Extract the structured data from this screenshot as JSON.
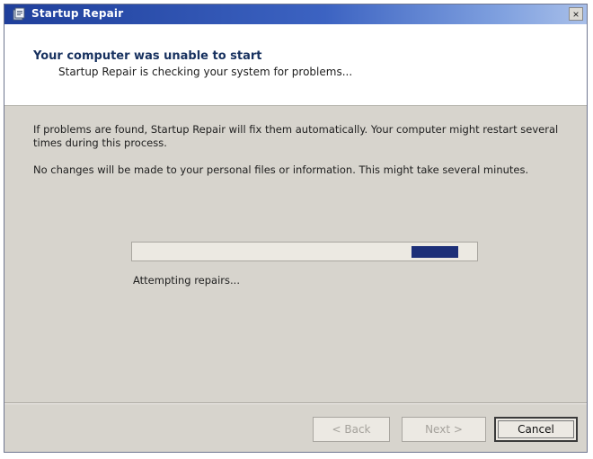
{
  "window": {
    "title": "Startup Repair",
    "close_glyph": "×",
    "icon": "app-icon"
  },
  "header": {
    "title": "Your computer was unable to start",
    "subtitle": "Startup Repair is checking your system for problems..."
  },
  "body": {
    "paragraph1": "If problems are found, Startup Repair will fix them automatically. Your computer might restart several times during this process.",
    "paragraph2": "No changes will be made to your personal files or information. This might take several minutes."
  },
  "progress": {
    "style": "marquee",
    "status": "Attempting repairs...",
    "color": "#1d2f78"
  },
  "buttons": {
    "back": "< Back",
    "next": "Next >",
    "cancel": "Cancel"
  },
  "colors": {
    "titlebar": "#1f3f9b",
    "dialog_bg": "#d7d4cd",
    "header_title": "#17315f"
  }
}
